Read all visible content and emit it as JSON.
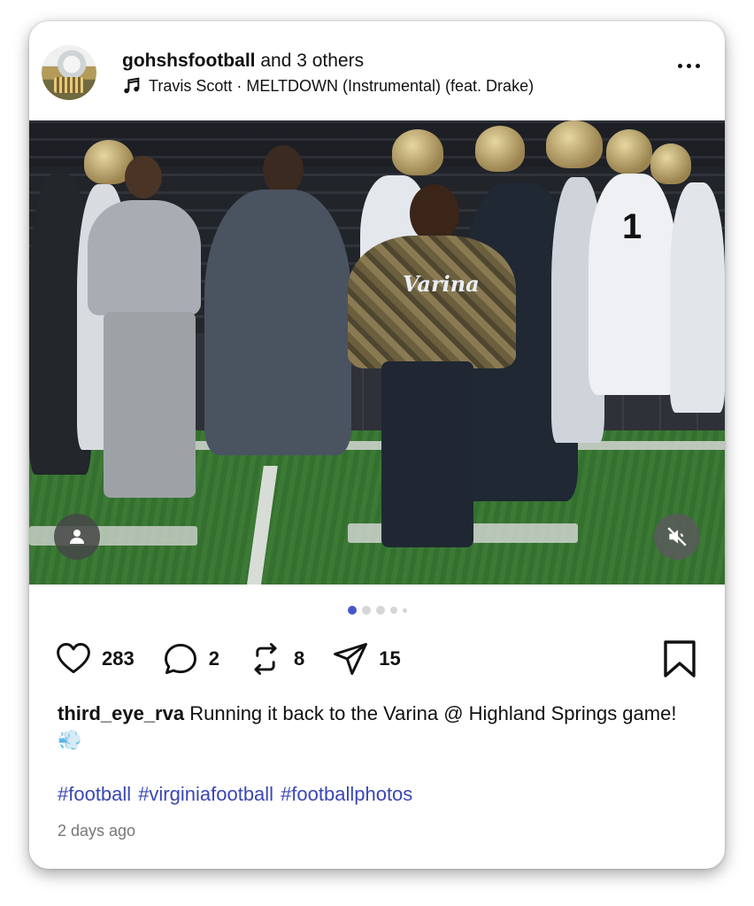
{
  "post": {
    "author": "gohshsfootball",
    "coauthors": "and 3 others",
    "music": "Travis Scott · MELTDOWN (Instrumental) (feat. Drake)",
    "caption_user": "third_eye_rva",
    "caption_text": "Running it back to the Varina @ Highland Springs game! 💨",
    "hashtags": [
      "#football",
      "#virginiafootball",
      "#footballphotos"
    ],
    "time": "2 days ago",
    "jersey_text": "Varina",
    "player_number": "1"
  },
  "actions": {
    "likes": "283",
    "comments": "2",
    "reposts": "8",
    "shares": "15"
  },
  "carousel": {
    "total_dots": 5,
    "active_index": 0
  },
  "icons": {
    "more": "more-horizontal-icon",
    "music": "music-note-icon",
    "user": "user-tag-icon",
    "mute": "speaker-muted-icon",
    "like": "heart-icon",
    "comment": "comment-bubble-icon",
    "repost": "repost-icon",
    "share": "send-icon",
    "bookmark": "bookmark-icon"
  },
  "colors": {
    "hashtag": "#3b47b5",
    "active_dot": "#4756c9"
  }
}
